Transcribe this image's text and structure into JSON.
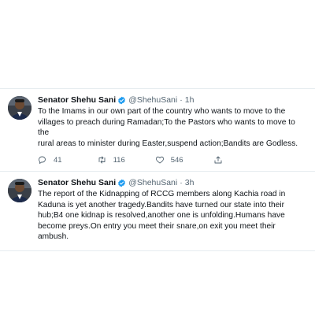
{
  "tweets": [
    {
      "name": "Senator Shehu Sani",
      "handle": "@ShehuSani",
      "dot": "·",
      "time": "1h",
      "lines": [
        "To the Imams in our own part of the country who wants to move to the",
        "villages to preach during Ramadan;To the Pastors who wants to move to the",
        "rural areas to minister during Easter,suspend action;Bandits are Godless."
      ],
      "replies": "41",
      "retweets": "116",
      "likes": "546"
    },
    {
      "name": "Senator Shehu Sani",
      "handle": "@ShehuSani",
      "dot": "·",
      "time": "3h",
      "lines": [
        "The report of the Kidnapping of RCCG members along Kachia road in",
        "Kaduna is yet another tragedy.Bandits have turned our state into their",
        "hub;B4 one kidnap is resolved,another one is unfolding.Humans have",
        "become preys.On entry you meet their snare,on exit you meet their ambush."
      ]
    }
  ],
  "colors": {
    "verified": "#1d9bf0",
    "muted": "#536471",
    "border": "#e6ecf0"
  }
}
